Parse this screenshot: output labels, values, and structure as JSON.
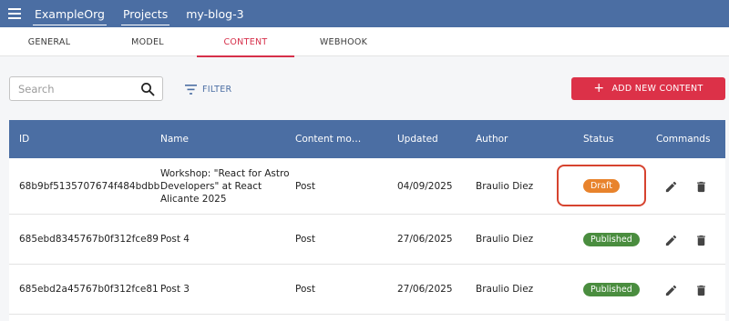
{
  "topbar": {
    "menu_icon": "hamburger-menu-icon",
    "org": "ExampleOrg",
    "projects": "Projects",
    "project_name": "my-blog-3"
  },
  "tabs": [
    {
      "label": "GENERAL",
      "active": false
    },
    {
      "label": "MODEL",
      "active": false
    },
    {
      "label": "CONTENT",
      "active": true
    },
    {
      "label": "WEBHOOK",
      "active": false
    }
  ],
  "toolbar": {
    "search_placeholder": "Search",
    "search_value": "",
    "filter_label": "FILTER",
    "add_label": "ADD NEW CONTENT"
  },
  "table": {
    "headers": [
      "ID",
      "Name",
      "Content mo…",
      "Updated",
      "Author",
      "Status",
      "Commands"
    ],
    "rows": [
      {
        "id": "68b9bf5135707674f484bdbb",
        "name_lines": [
          "Workshop: \"React for Astro",
          "Developers\" at React",
          "Alicante 2025"
        ],
        "model": "Post",
        "updated": "04/09/2025",
        "author": "Braulio Diez",
        "status": "Draft",
        "highlighted": true
      },
      {
        "id": "685ebd8345767b0f312fce89",
        "name_lines": [
          "Post 4"
        ],
        "model": "Post",
        "updated": "27/06/2025",
        "author": "Braulio Diez",
        "status": "Published",
        "highlighted": false
      },
      {
        "id": "685ebd2a45767b0f312fce81",
        "name_lines": [
          "Post 3"
        ],
        "model": "Post",
        "updated": "27/06/2025",
        "author": "Braulio Diez",
        "status": "Published",
        "highlighted": false
      }
    ]
  },
  "colors": {
    "primary": "#4b6ea3",
    "accent": "#dc3148",
    "draft": "#e8832c",
    "published": "#4a8d3f",
    "highlight": "#d6432f"
  },
  "icons": {
    "edit": "pencil-icon",
    "delete": "trash-icon",
    "search": "search-icon",
    "filter": "filter-icon"
  }
}
